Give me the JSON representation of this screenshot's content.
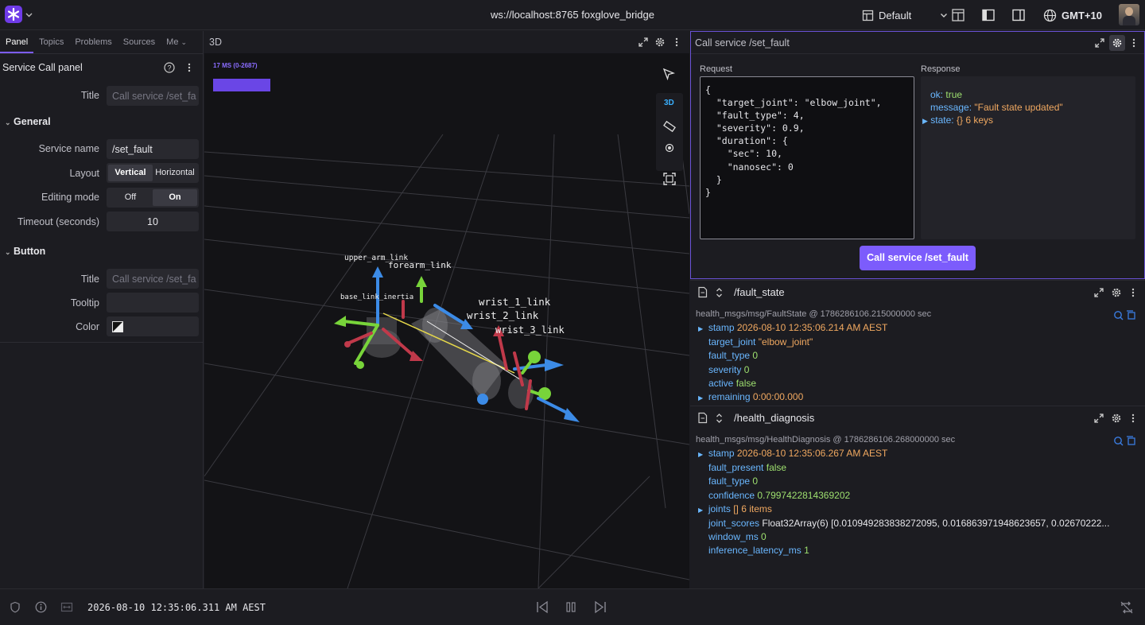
{
  "topbar": {
    "connection": "ws://localhost:8765 foxglove_bridge",
    "layout_name": "Default",
    "timezone": "GMT+10"
  },
  "sidebar": {
    "tabs": [
      {
        "label": "Panel",
        "active": true
      },
      {
        "label": "Topics",
        "active": false
      },
      {
        "label": "Problems",
        "active": false
      },
      {
        "label": "Sources",
        "active": false
      },
      {
        "label": "Me",
        "active": false
      }
    ],
    "panel_title": "Service Call panel",
    "title_label": "Title",
    "title_placeholder": "Call service /set_fa",
    "general_section": "General",
    "service_name_label": "Service name",
    "service_name_value": "/set_fault",
    "layout_label": "Layout",
    "layout_options": [
      "Vertical",
      "Horizontal"
    ],
    "editing_mode_label": "Editing mode",
    "editing_mode_options": [
      "Off",
      "On"
    ],
    "timeout_label": "Timeout (seconds)",
    "timeout_value": "10",
    "button_section": "Button",
    "button_title_label": "Title",
    "button_title_placeholder": "Call service /set_fa",
    "tooltip_label": "Tooltip",
    "tooltip_value": "",
    "color_label": "Color"
  },
  "viewport": {
    "title": "3D",
    "perf_label": "17 MS (0-2687)",
    "mode_label": "3D",
    "frame_labels": {
      "upper_arm": "upper_arm_link",
      "forearm": "forearm_link",
      "base_inertia": "base_link_inertia",
      "wrist_1": "wrist_1_link",
      "wrist_2": "wrist_2_link",
      "wrist_3": "wrist_3_link"
    }
  },
  "service_panel": {
    "title": "Call service /set_fault",
    "request_label": "Request",
    "response_label": "Response",
    "request_text": "{\n  \"target_joint\": \"elbow_joint\",\n  \"fault_type\": 4,\n  \"severity\": 0.9,\n  \"duration\": {\n    \"sec\": 10,\n    \"nanosec\": 0\n  }\n}",
    "response": {
      "ok_key": "ok:",
      "ok_value": "true",
      "message_key": "message:",
      "message_value": "\"Fault state updated\"",
      "state_key": "state:",
      "state_value": "{}  6 keys"
    },
    "button_label": "Call service /set_fault"
  },
  "fault_state": {
    "topic": "/fault_state",
    "datatype": "health_msgs/msg/FaultState @ 1786286106.215000000 sec",
    "stamp_key": "stamp",
    "stamp_value": "2026-08-10 12:35:06.214 AM AEST",
    "target_joint_key": "target_joint",
    "target_joint_value": "\"elbow_joint\"",
    "fault_type_key": "fault_type",
    "fault_type_value": "0",
    "severity_key": "severity",
    "severity_value": "0",
    "active_key": "active",
    "active_value": "false",
    "remaining_key": "remaining",
    "remaining_value": "0:00:00.000"
  },
  "health_diagnosis": {
    "topic": "/health_diagnosis",
    "datatype": "health_msgs/msg/HealthDiagnosis @ 1786286106.268000000 sec",
    "stamp_key": "stamp",
    "stamp_value": "2026-08-10 12:35:06.267 AM AEST",
    "fault_present_key": "fault_present",
    "fault_present_value": "false",
    "fault_type_key": "fault_type",
    "fault_type_value": "0",
    "confidence_key": "confidence",
    "confidence_value": "0.7997422814369202",
    "joints_key": "joints",
    "joints_value": "[] 6 items",
    "joint_scores_key": "joint_scores",
    "joint_scores_value": "Float32Array(6) [0.010949283838272095, 0.016863971948623657, 0.02670222...",
    "window_ms_key": "window_ms",
    "window_ms_value": "0",
    "inference_latency_key": "inference_latency_ms",
    "inference_latency_value": "1"
  },
  "bottom": {
    "timestamp": "2026-08-10 12:35:06.311 AM AEST"
  },
  "colors": {
    "accent": "#7c5cfc",
    "key": "#6ab7ff",
    "string": "#f0a860",
    "number": "#9ee06f"
  }
}
